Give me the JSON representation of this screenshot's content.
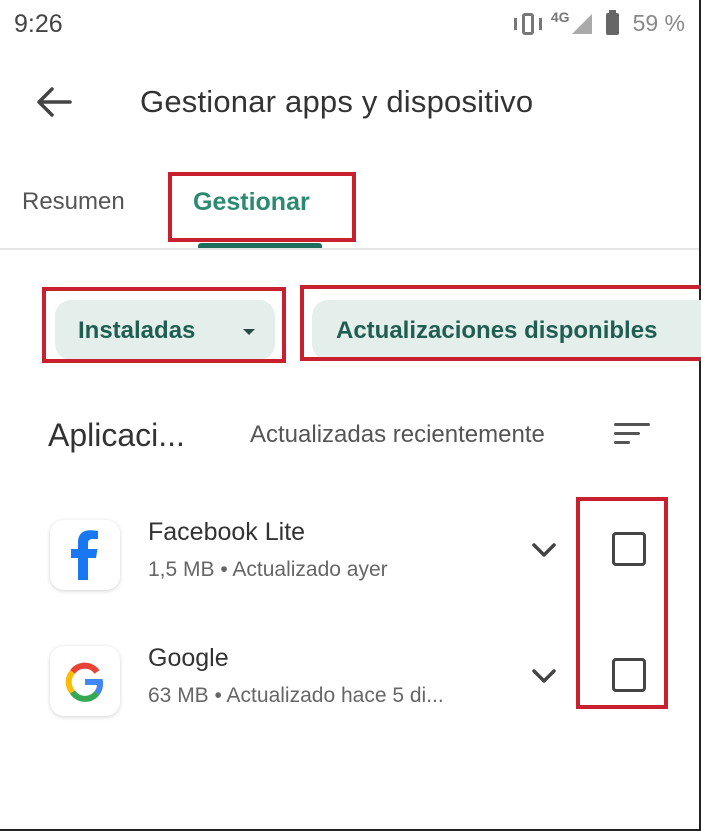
{
  "status_bar": {
    "time": "9:26",
    "network": "4G",
    "battery": "59 %",
    "icons": [
      "vibrate-icon",
      "signal-icon",
      "battery-icon"
    ]
  },
  "header": {
    "title": "Gestionar apps y dispositivo",
    "back_icon": "arrow-left-icon"
  },
  "tabs": [
    {
      "label": "Resumen",
      "active": false
    },
    {
      "label": "Gestionar",
      "active": true
    }
  ],
  "filters": {
    "installed_label": "Instaladas",
    "updates_label": "Actualizaciones disponibles"
  },
  "section": {
    "title": "Aplicaci...",
    "sort_label": "Actualizadas recientemente",
    "sort_icon": "sort-icon"
  },
  "apps": [
    {
      "name": "Facebook Lite",
      "meta": "1,5 MB  •  Actualizado ayer",
      "icon": "facebook-icon",
      "checked": false
    },
    {
      "name": "Google",
      "meta": "63 MB  •  Actualizado hace 5 di...",
      "icon": "google-icon",
      "checked": false
    }
  ],
  "colors": {
    "accent": "#2c8a72",
    "indicator": "#1f6e5c",
    "chip_bg": "#e4efec",
    "highlight": "#c8202e"
  }
}
